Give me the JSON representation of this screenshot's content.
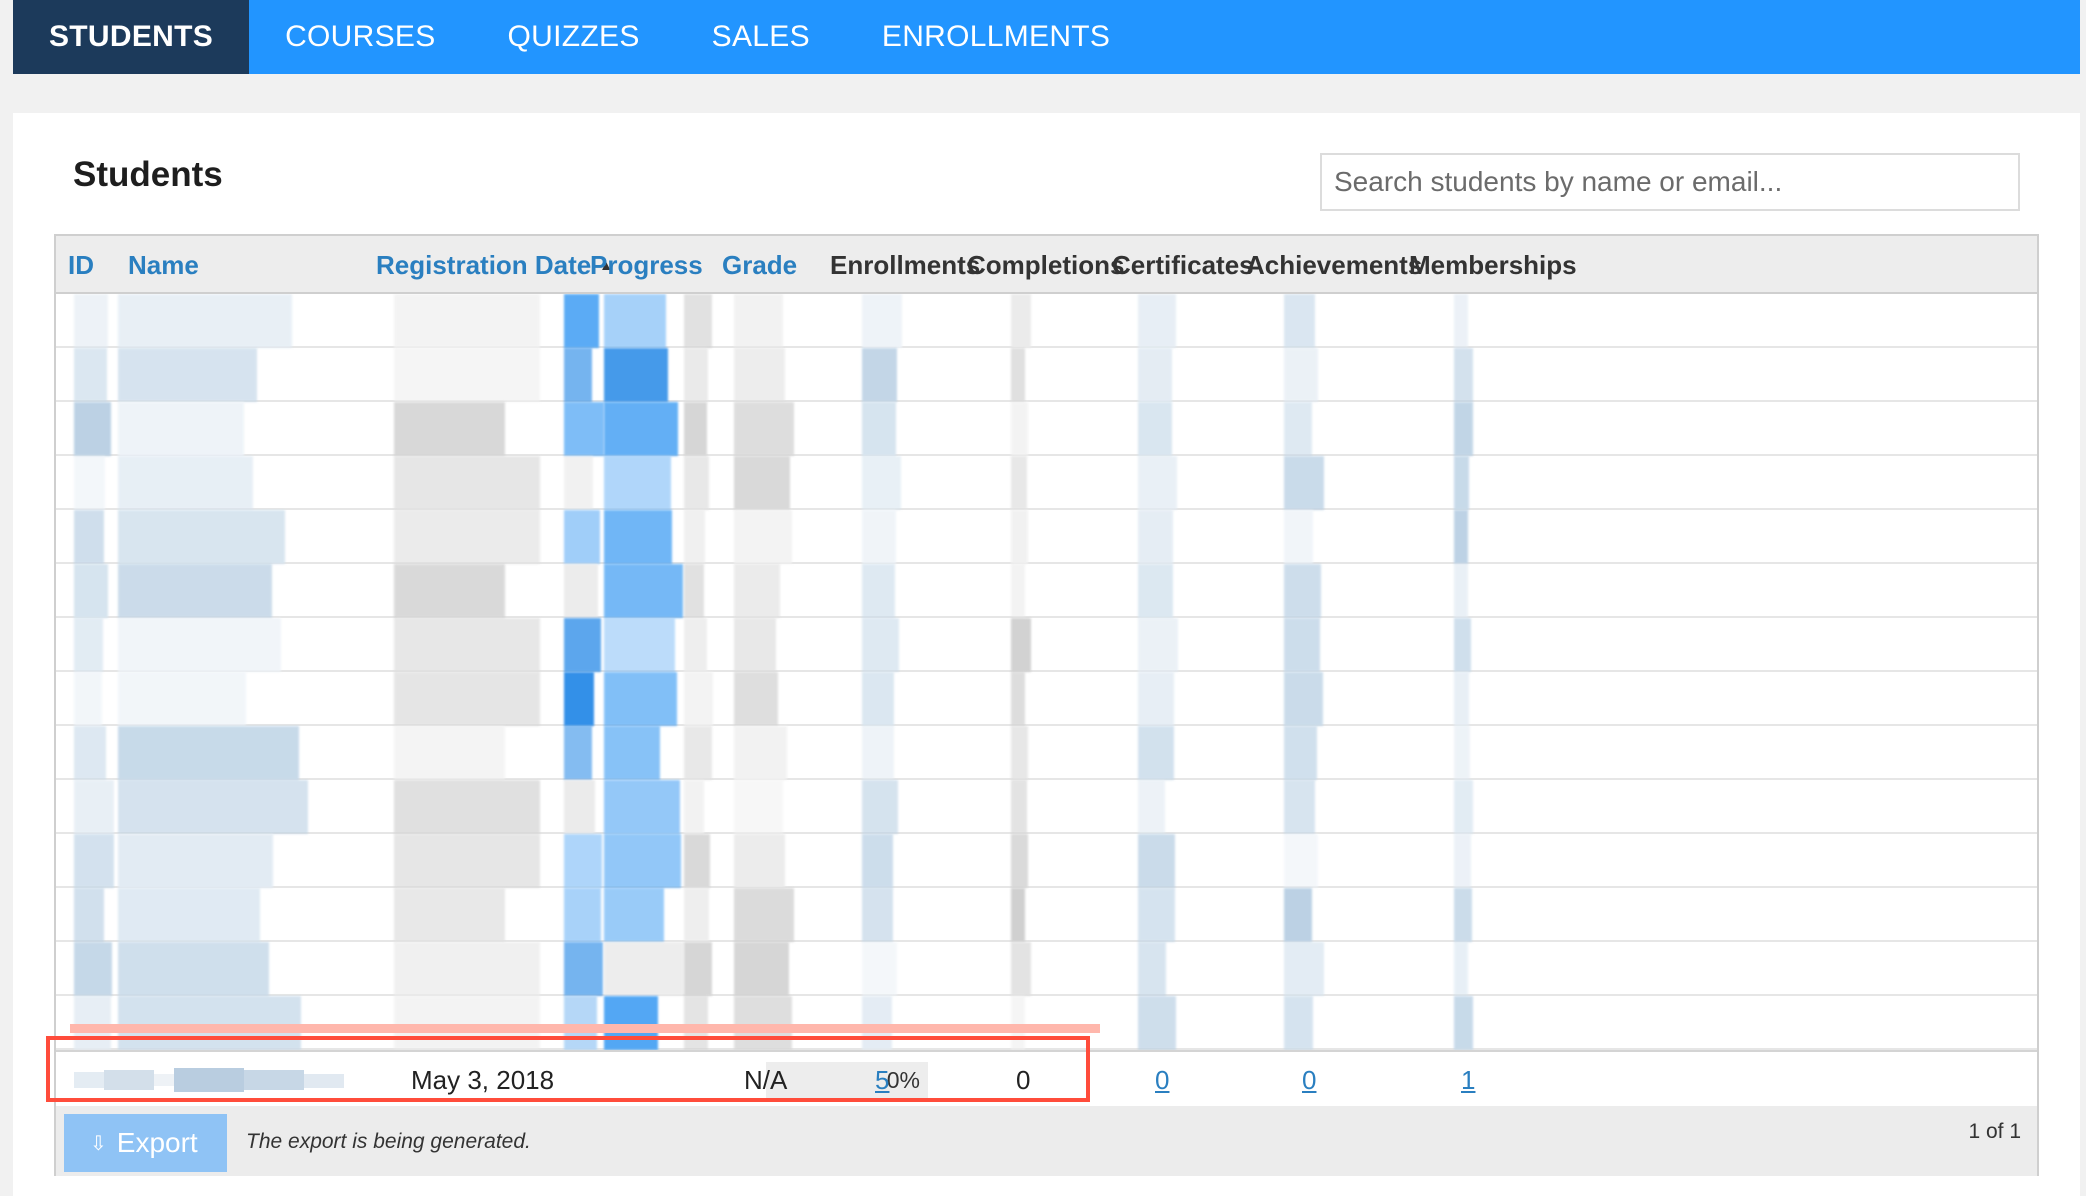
{
  "nav": {
    "tabs": [
      {
        "label": "STUDENTS",
        "active": true
      },
      {
        "label": "COURSES",
        "active": false
      },
      {
        "label": "QUIZZES",
        "active": false
      },
      {
        "label": "SALES",
        "active": false
      },
      {
        "label": "ENROLLMENTS",
        "active": false
      }
    ]
  },
  "page": {
    "title": "Students",
    "search_placeholder": "Search students by name or email..."
  },
  "table": {
    "columns": {
      "id": "ID",
      "name": "Name",
      "registration_date": "Registration Date",
      "progress": "Progress",
      "grade": "Grade",
      "enrollments": "Enrollments",
      "completions": "Completions",
      "certificates": "Certificates",
      "achievements": "Achievements",
      "memberships": "Memberships"
    },
    "sorted_by": "registration_date",
    "sort_direction": "ascending",
    "highlighted_row": {
      "registration_date": "May 3, 2018",
      "progress": "0%",
      "progress_value": 0,
      "grade": "N/A",
      "enrollments": "5",
      "completions": "0",
      "certificates": "0",
      "achievements": "0",
      "memberships": "1"
    }
  },
  "footer": {
    "export_label": "Export",
    "export_status": "The export is being generated.",
    "pagination": "1 of 1"
  },
  "colors": {
    "nav_bg": "#2295ff",
    "nav_active_bg": "#1c3a5b",
    "link": "#2a7fc0",
    "highlight_border": "#ff4c3b",
    "export_button": "#8fc3f5"
  }
}
